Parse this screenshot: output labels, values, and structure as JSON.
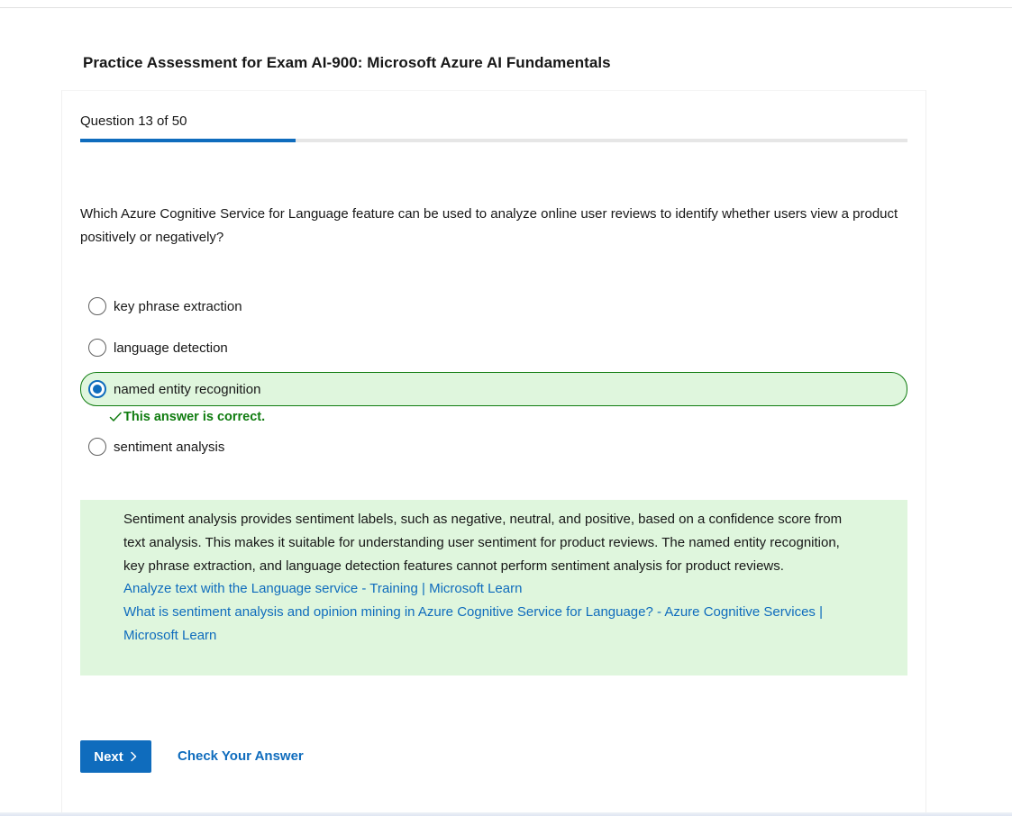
{
  "page": {
    "title": "Practice Assessment for Exam AI-900: Microsoft Azure AI Fundamentals"
  },
  "progress": {
    "label": "Question 13 of 50",
    "current": 13,
    "total": 50,
    "fraction": 0.26
  },
  "question": {
    "text": "Which Azure Cognitive Service for Language feature can be used to analyze online user reviews to identify whether users view a product positively or negatively?",
    "options": [
      {
        "label": "key phrase extraction",
        "selected": false
      },
      {
        "label": "language detection",
        "selected": false
      },
      {
        "label": "named entity recognition",
        "selected": true
      },
      {
        "label": "sentiment analysis",
        "selected": false
      }
    ],
    "feedback": "This answer is correct."
  },
  "explanation": {
    "text": "Sentiment analysis provides sentiment labels, such as negative, neutral, and positive, based on a confidence score from text analysis. This makes it suitable for understanding user sentiment for product reviews. The named entity recognition, key phrase extraction, and language detection features cannot perform sentiment analysis for product reviews.",
    "links": [
      "Analyze text with the Language service - Training | Microsoft Learn",
      "What is sentiment analysis and opinion mining in Azure Cognitive Service for Language? - Azure Cognitive Services | Microsoft Learn"
    ]
  },
  "actions": {
    "next_label": "Next",
    "check_label": "Check Your Answer"
  },
  "colors": {
    "accent": "#0f6cbd",
    "success": "#107c10",
    "success_bg": "#dff6dd"
  }
}
